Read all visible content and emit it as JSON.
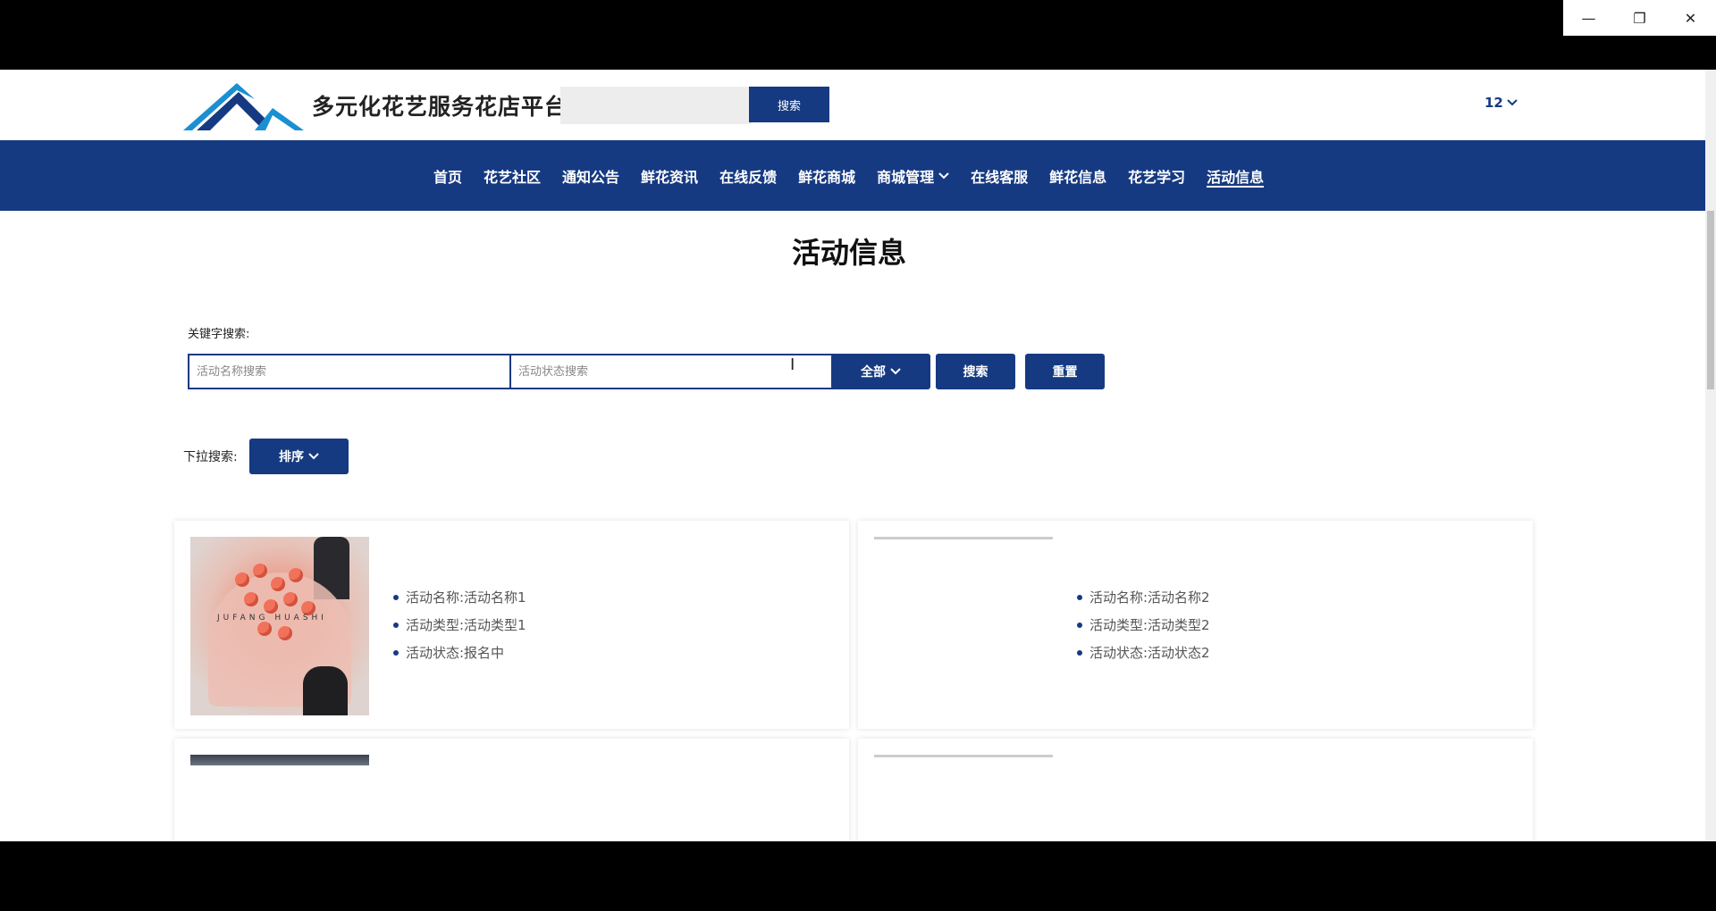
{
  "window": {
    "minimize_icon": "minimize-icon",
    "maximize_icon": "restore-icon",
    "close_icon": "close-icon"
  },
  "header": {
    "site_title": "多元化花艺服务花店平台",
    "search_button": "搜索",
    "user_label": "12"
  },
  "nav": {
    "items": [
      {
        "label": "首页"
      },
      {
        "label": "花艺社区"
      },
      {
        "label": "通知公告"
      },
      {
        "label": "鲜花资讯"
      },
      {
        "label": "在线反馈"
      },
      {
        "label": "鲜花商城"
      },
      {
        "label": "商城管理"
      },
      {
        "label": "在线客服"
      },
      {
        "label": "鲜花信息"
      },
      {
        "label": "花艺学习"
      },
      {
        "label": "活动信息"
      }
    ],
    "active": "活动信息"
  },
  "main": {
    "page_title": "活动信息",
    "keyword_label": "关键字搜索:",
    "name_placeholder": "活动名称搜索",
    "status_placeholder": "活动状态搜索",
    "all_button": "全部",
    "search_button": "搜索",
    "reset_button": "重置",
    "dropdown_label": "下拉搜索:",
    "sort_button": "排序"
  },
  "cards": [
    {
      "name": "活动名称:活动名称1",
      "type": "活动类型:活动类型1",
      "status": "活动状态:报名中",
      "image_text": "JUFANG HUASHI"
    },
    {
      "name": "活动名称:活动名称2",
      "type": "活动类型:活动类型2",
      "status": "活动状态:活动状态2"
    }
  ],
  "colors": {
    "primary": "#163a82",
    "logo_blue": "#1a8fd1",
    "logo_navy": "#163a82"
  }
}
